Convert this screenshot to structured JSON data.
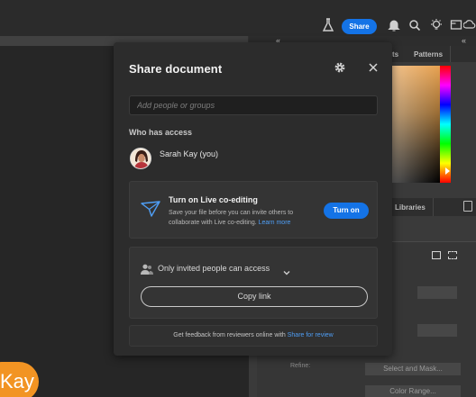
{
  "topbar": {
    "share_label": "Share",
    "icons": [
      "flask-icon",
      "bell-icon",
      "search-icon",
      "lightbulb-icon",
      "frame-icon",
      "cloud-sync-icon"
    ]
  },
  "canvas": {
    "avatar_text": "Kay",
    "accent": "#f29423"
  },
  "right_panel": {
    "tab_top_partial": "ts",
    "tab_patterns": "Patterns",
    "tab_libraries": "Libraries",
    "collapse_glyph": "«",
    "refine_label": "Refine:",
    "select_mask_label": "Select and Mask...",
    "color_range_label": "Color Range..."
  },
  "dialog": {
    "title": "Share document",
    "icons": {
      "settings": "gear-icon",
      "close": "close-icon"
    },
    "people_placeholder": "Add people or groups",
    "access_heading": "Who has access",
    "user_name": "Sarah Kay (you)",
    "coedit": {
      "title": "Turn on Live co-editing",
      "desc": "Save your file before you can invite others to collaborate with Live co-editing.",
      "learn_more": "Learn more",
      "button": "Turn on"
    },
    "permission": {
      "label": "Only invited people can access",
      "copy_link": "Copy link"
    },
    "feedback": {
      "text": "Get feedback from reviewers online with",
      "link": "Share for review"
    }
  },
  "colors": {
    "accent_blue": "#1473e6",
    "link_blue": "#4f9ef5",
    "dialog_bg": "#2c2c2c"
  }
}
